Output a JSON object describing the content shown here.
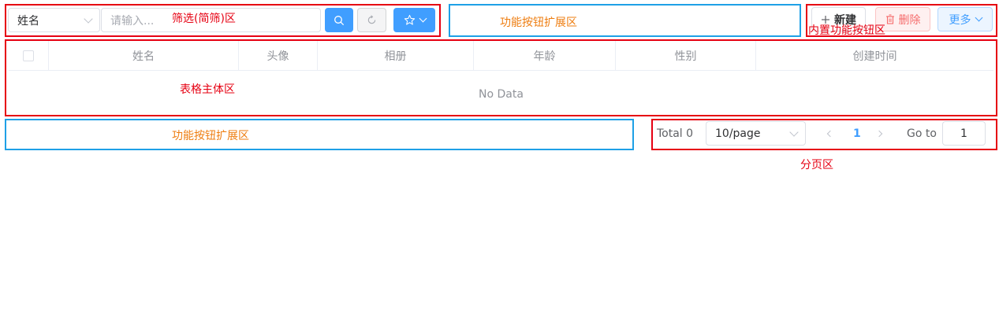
{
  "filter": {
    "field_select_value": "姓名",
    "search_placeholder": "请输入...",
    "annotation": "筛选(简筛)区"
  },
  "toolbar_extension_top": {
    "annotation": "功能按钮扩展区"
  },
  "builtin_buttons": {
    "annotation": "内置功能按钮区",
    "new_label": "新建",
    "delete_label": "删除",
    "more_label": "更多"
  },
  "table": {
    "annotation": "表格主体区",
    "columns": [
      "姓名",
      "头像",
      "相册",
      "年龄",
      "性别",
      "创建时间"
    ],
    "empty_text": "No Data"
  },
  "toolbar_extension_bottom": {
    "annotation": "功能按钮扩展区"
  },
  "pagination": {
    "annotation": "分页区",
    "total_label": "Total 0",
    "page_size_value": "10/page",
    "current_page": "1",
    "goto_label": "Go to",
    "goto_value": "1"
  },
  "colors": {
    "primary": "#409eff",
    "danger": "#f56c6c",
    "annotation_red": "#e60012",
    "annotation_blue": "#1ea0e6",
    "annotation_orange": "#ee7d10"
  },
  "icons": [
    "search-icon",
    "refresh-icon",
    "star-icon",
    "plus-icon",
    "trash-icon"
  ]
}
